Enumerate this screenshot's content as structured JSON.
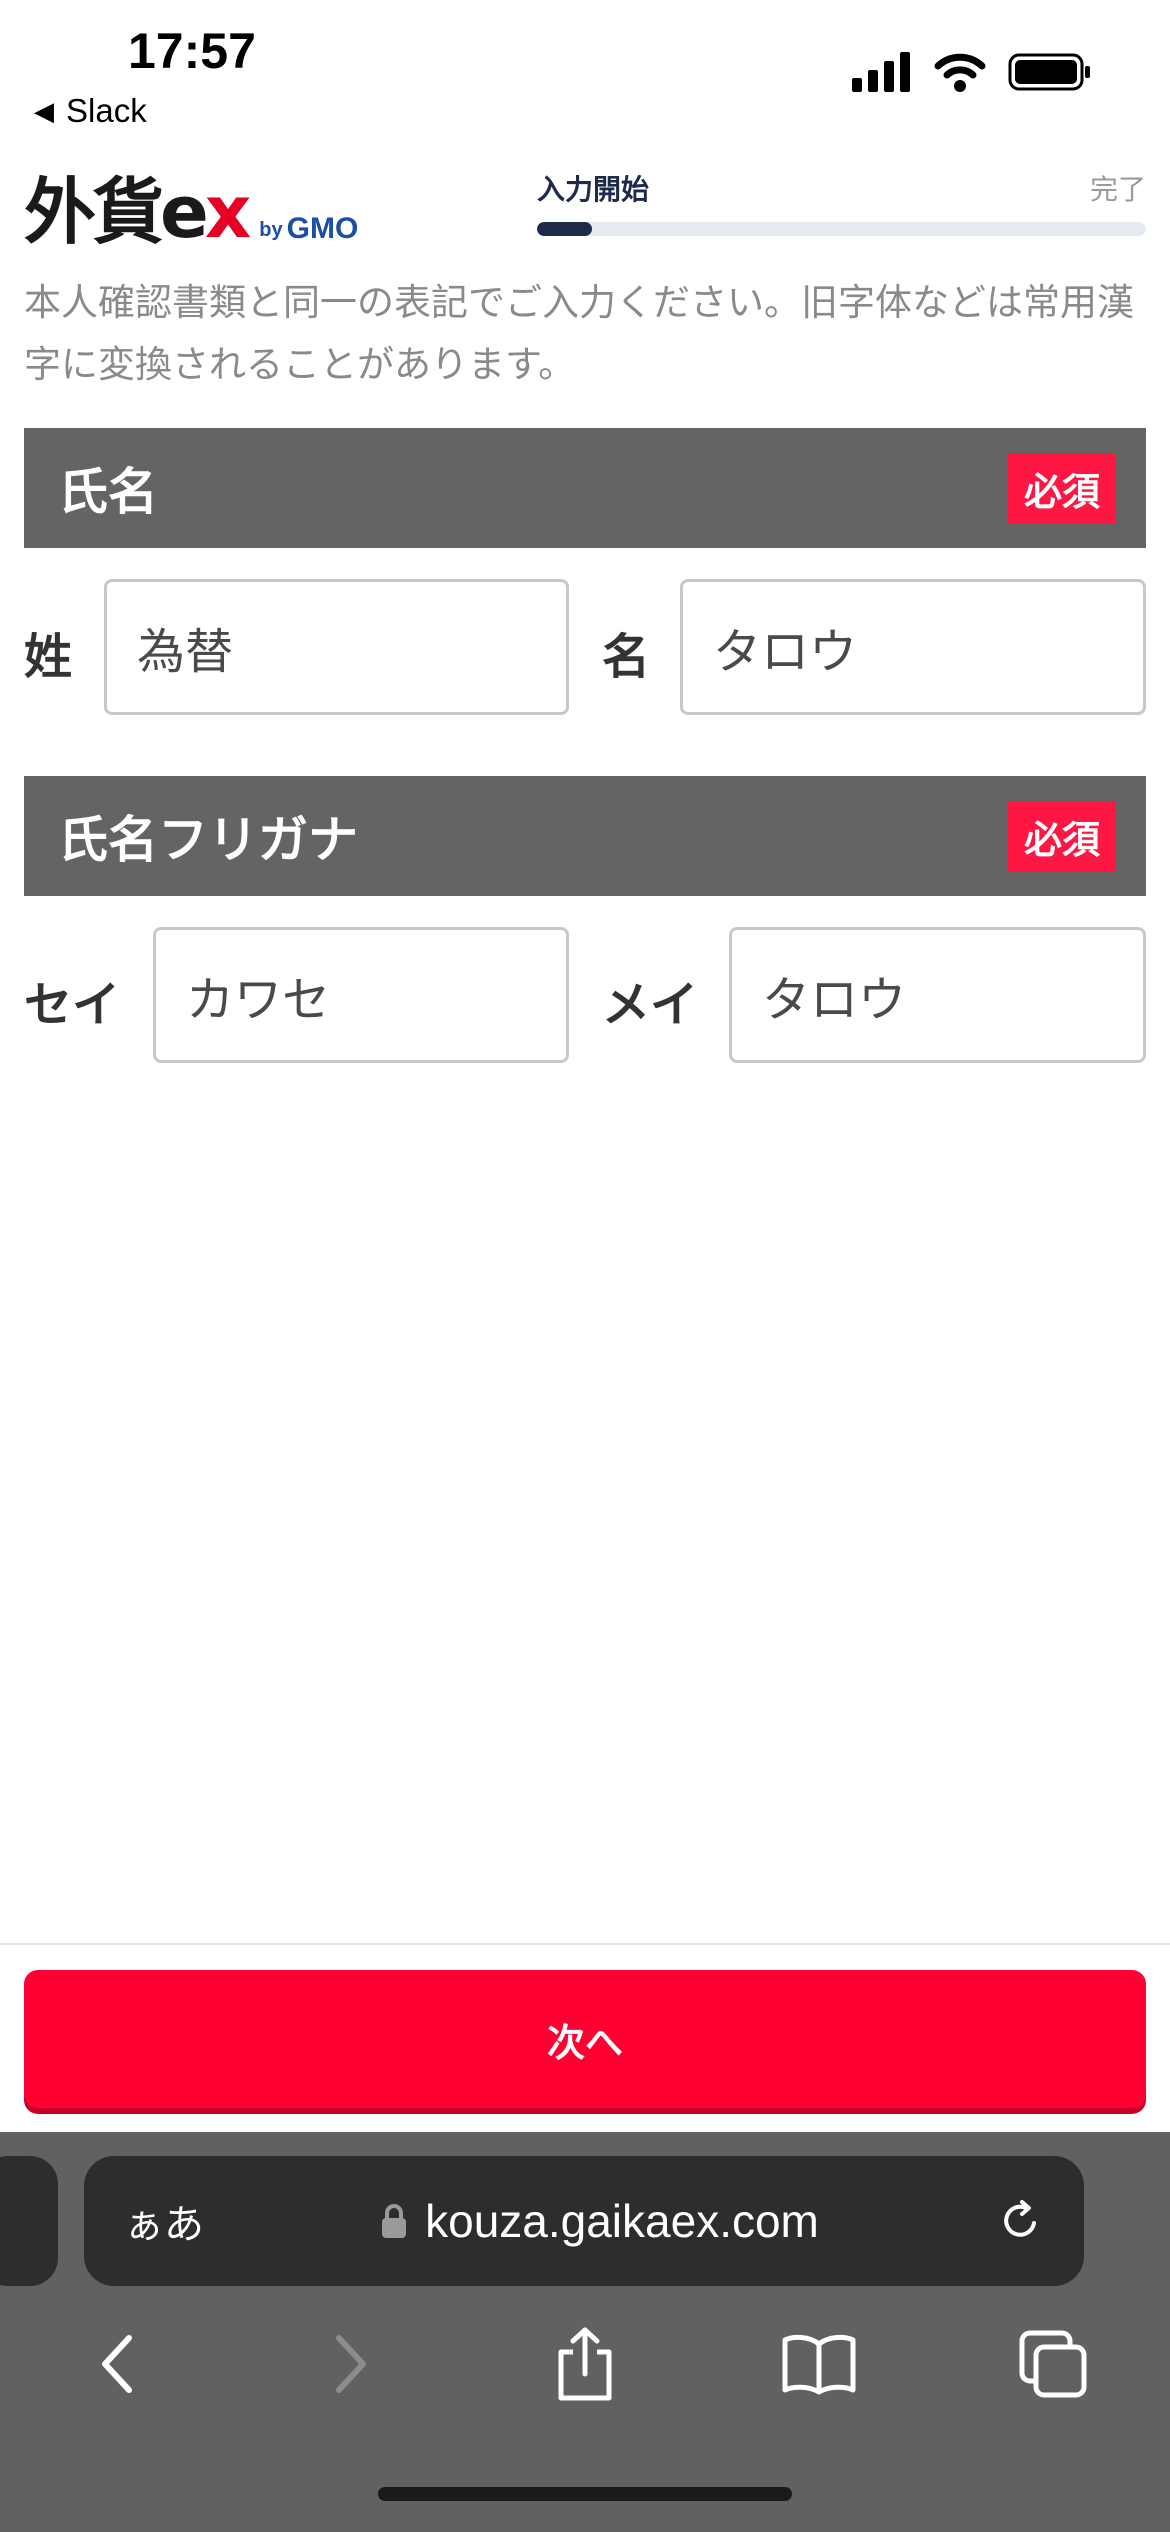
{
  "status_bar": {
    "time": "17:57",
    "back_app": "Slack"
  },
  "header": {
    "logo": {
      "main": "外貨e",
      "x": "x",
      "by": "by",
      "brand": "GMO"
    },
    "progress": {
      "start_label": "入力開始",
      "end_label": "完了",
      "fraction": 0.09
    }
  },
  "notice": "本人確認書類と同一の表記でご入力ください。旧字体などは常用漢字に変換されることがあります。",
  "name_section": {
    "title": "氏名",
    "required": "必須",
    "last_label": "姓",
    "last_value": "為替",
    "first_label": "名",
    "first_value": "タロウ"
  },
  "kana_section": {
    "title": "氏名フリガナ",
    "required": "必須",
    "last_label": "セイ",
    "last_value": "カワセ",
    "first_label": "メイ",
    "first_value": "タロウ"
  },
  "actions": {
    "next_label": "次へ"
  },
  "browser": {
    "aa_label": "ぁあ",
    "url": "kouza.gaikaex.com",
    "icons": [
      "lock-icon",
      "reload-icon",
      "back-icon",
      "forward-icon",
      "share-icon",
      "bookmarks-icon",
      "tabs-icon"
    ]
  },
  "colors": {
    "accent": "#ff0033",
    "navy": "#1e2a4a",
    "section_bg": "#646464",
    "badge": "#ff1744"
  }
}
